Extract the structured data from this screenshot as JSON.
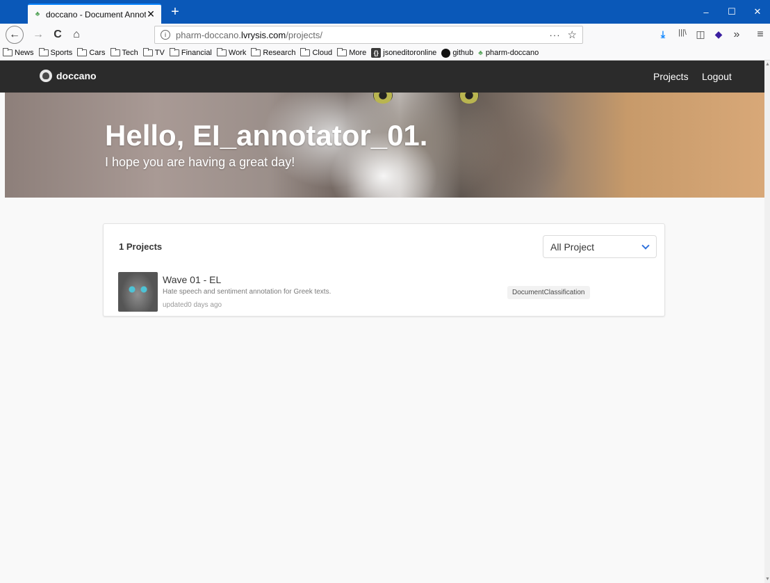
{
  "browser": {
    "tab": {
      "title": "doccano - Document Annotati",
      "close": "✕"
    },
    "new_tab": "+",
    "window_controls": {
      "minimize": "–",
      "maximize": "☐",
      "close": "✕"
    },
    "url": {
      "prefix": "pharm-doccano.",
      "host": "lvrysis.com",
      "path": "/projects/",
      "more": "···",
      "star": "☆"
    },
    "toolbar_icons": {
      "back": "←",
      "forward": "→",
      "reload": "C",
      "home": "⌂",
      "download": "⤓",
      "library": "|||\\",
      "sidebar": "◫",
      "extension": "◆",
      "overflow": "»",
      "menu": "≡"
    },
    "bookmarks": [
      {
        "label": "News",
        "icon": "folder-icon"
      },
      {
        "label": "Sports",
        "icon": "folder-icon"
      },
      {
        "label": "Cars",
        "icon": "folder-icon"
      },
      {
        "label": "Tech",
        "icon": "folder-icon"
      },
      {
        "label": "TV",
        "icon": "folder-icon"
      },
      {
        "label": "Financial",
        "icon": "folder-icon"
      },
      {
        "label": "Work",
        "icon": "folder-icon"
      },
      {
        "label": "Research",
        "icon": "folder-icon"
      },
      {
        "label": "Cloud",
        "icon": "folder-icon"
      },
      {
        "label": "More",
        "icon": "folder-icon"
      },
      {
        "label": "jsoneditoronline",
        "icon": "braces-icon",
        "badge": "{}"
      },
      {
        "label": "github",
        "icon": "github-icon"
      },
      {
        "label": "pharm-doccano",
        "icon": "leaf-icon"
      }
    ]
  },
  "app": {
    "brand": "doccano",
    "nav": {
      "projects": "Projects",
      "logout": "Logout"
    },
    "hero": {
      "title": "Hello, EI_annotator_01.",
      "subtitle": "I hope you are having a great day!"
    },
    "projects_panel": {
      "count_label": "1 Projects",
      "filter": {
        "selected": "All Project"
      },
      "items": [
        {
          "name": "Wave 01 - EL",
          "description": "Hate speech and sentiment annotation for Greek texts.",
          "updated": "updated0 days ago",
          "type": "DocumentClassification"
        }
      ]
    }
  }
}
